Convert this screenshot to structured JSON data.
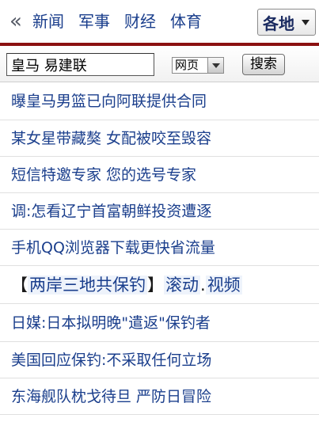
{
  "nav": {
    "arrow": "«",
    "items": [
      "新闻",
      "军事",
      "财经",
      "体育"
    ],
    "region_label": "各地"
  },
  "search": {
    "value": "皇马 易建联",
    "type_label": "网页",
    "button_label": "搜索"
  },
  "news": [
    "曝皇马男篮已向阿联提供合同",
    "某女星带藏獒 女配被咬至毁容",
    "短信特邀专家 您的选号专家",
    "调:怎看辽宁首富朝鲜投资遭逐",
    "手机QQ浏览器下载更快省流量"
  ],
  "feature": {
    "open_bracket": "【",
    "topic": "两岸三地共保钓",
    "close_bracket": "】",
    "link1": "滚动",
    "dot": ".",
    "link2": "视频"
  },
  "news2": [
    "日媒:日本拟明晚\"遣返\"保钓者",
    "美国回应保钓:不采取任何立场",
    "东海舰队枕戈待旦 严防日冒险"
  ],
  "colors": {
    "link": "#1a3e8c",
    "accent_rule": "#8b1010"
  }
}
